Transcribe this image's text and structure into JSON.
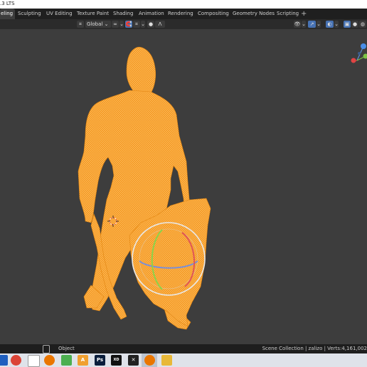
{
  "app": {
    "version_label": ".3 LTS"
  },
  "tabs": [
    {
      "label": "eling",
      "active": true
    },
    {
      "label": "Sculpting"
    },
    {
      "label": "UV Editing"
    },
    {
      "label": "Texture Paint"
    },
    {
      "label": "Shading"
    },
    {
      "label": "Animation"
    },
    {
      "label": "Rendering"
    },
    {
      "label": "Compositing"
    },
    {
      "label": "Geometry Nodes"
    },
    {
      "label": "Scripting"
    }
  ],
  "add_tab_label": "+",
  "header": {
    "transform_orientation": "Global",
    "chevron": "⌄",
    "proportional_label": "Λ"
  },
  "gizmo": {
    "z_label": "Z",
    "y_label": "Y"
  },
  "status": {
    "mouse_label": "Object",
    "right_text": "Scene Collection | zalizo | Verts:4,161,002"
  },
  "taskbar_icons": [
    {
      "name": "windows-start-icon",
      "color": "#1f5fbf",
      "glyph": ""
    },
    {
      "name": "chrome-icon",
      "color": "#db4437",
      "glyph": ""
    },
    {
      "name": "app-icon-1",
      "color": "#ffffff",
      "glyph": ""
    },
    {
      "name": "blender-icon",
      "color": "#ea7600",
      "glyph": ""
    },
    {
      "name": "app-icon-2",
      "color": "#4caf50",
      "glyph": ""
    },
    {
      "name": "app-icon-3",
      "color": "#f0a030",
      "glyph": "A"
    },
    {
      "name": "photoshop-icon",
      "color": "#0a1e3c",
      "glyph": "Ps"
    },
    {
      "name": "app-icon-4",
      "color": "#111111",
      "glyph": "XD"
    },
    {
      "name": "app-icon-5",
      "color": "#222222",
      "glyph": "✕"
    },
    {
      "name": "blender-icon-2",
      "color": "#ea7600",
      "glyph": ""
    },
    {
      "name": "folder-icon",
      "color": "#e8b838",
      "glyph": ""
    }
  ],
  "colors": {
    "selection_orange": "#f59a24",
    "active_blue": "#4772b3"
  }
}
